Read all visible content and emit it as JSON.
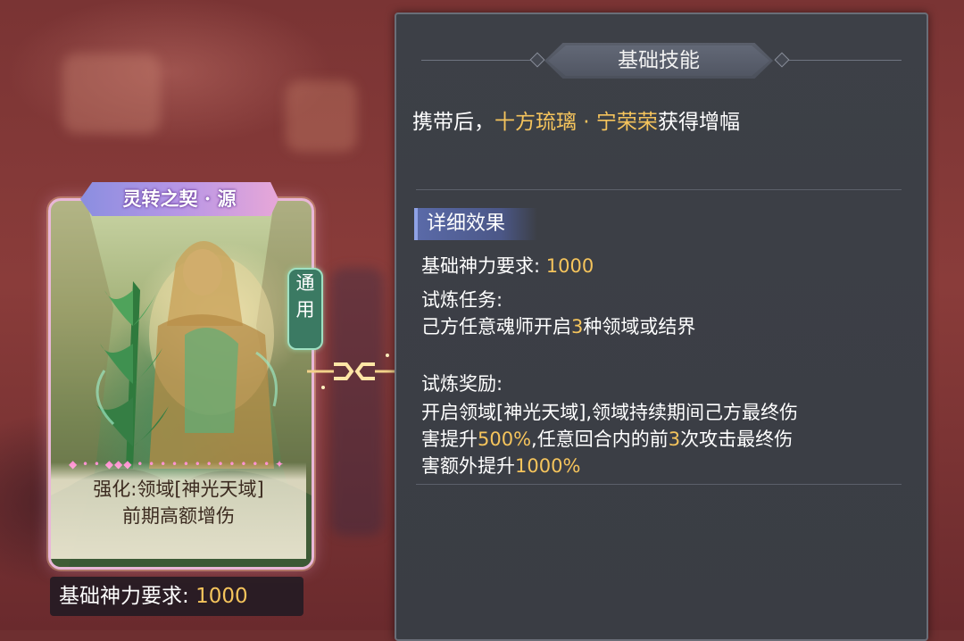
{
  "card": {
    "title": "灵转之契 · 源",
    "side_tag": [
      "通",
      "用"
    ],
    "desc_line1": "强化:领域[神光天域]",
    "desc_line2": "前期高额增伤",
    "req_label": "基础神力要求: ",
    "req_value": "1000"
  },
  "panel": {
    "header": "基础技能",
    "carry_prefix": "携带后，",
    "carry_name": "十方琉璃 · 宁荣荣",
    "carry_suffix": "获得增幅",
    "section_title": "详细效果",
    "req_label": "基础神力要求: ",
    "req_value": "1000",
    "trial_task_label": "试炼任务:",
    "trial_task_pre": "己方任意魂师开启",
    "trial_task_num": "3",
    "trial_task_post": "种领域或结界",
    "trial_reward_label": "试炼奖励:",
    "reward_line1": "开启领域[神光天域],领域持续期间己方最终伤",
    "reward_line2_pre": "害提升",
    "reward_line2_pct": "500%",
    "reward_line2_mid": ",任意回合内的前",
    "reward_line2_num": "3",
    "reward_line2_post": "次攻击最终伤",
    "reward_line3_pre": "害额外提升",
    "reward_line3_pct": "1000%"
  },
  "colors": {
    "highlight_gold": "#f5c45c",
    "highlight_green": "#7fe58c",
    "panel_bg": "#3d4047",
    "card_frame": "#e9b7d8"
  }
}
